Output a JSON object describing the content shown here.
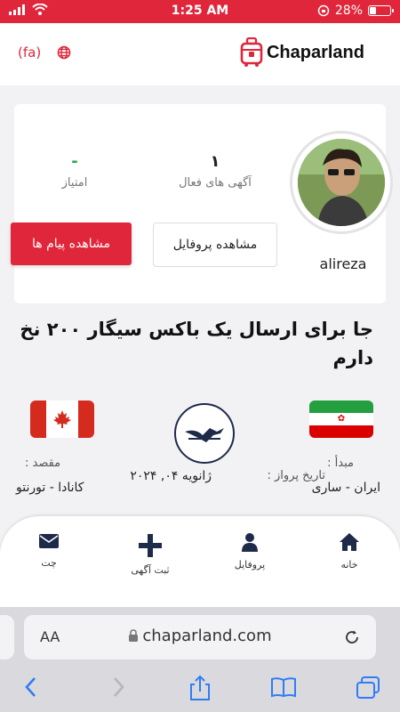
{
  "status_bar": {
    "time": "1:25 AM",
    "battery": "28%",
    "battery_level": 0.28
  },
  "header": {
    "language": "(fa)",
    "brand": "Chaparland",
    "accent_color": "#e0263b"
  },
  "profile": {
    "username": "alireza",
    "active_ads_value": "۱",
    "active_ads_label": "آگهی های فعال",
    "rating_value": "-",
    "rating_label": "امتیاز",
    "view_profile_label": "مشاهده پروفایل",
    "view_messages_label": "مشاهده پیام ها"
  },
  "listing": {
    "title": "جا برای ارسال یک باکس سیگار ۲۰۰ نخ دارم",
    "origin_label": "مبدأ :",
    "origin_value": "ایران - ساری",
    "flight_date_label": "تاریخ پرواز :",
    "flight_date_value": "ژانویه ۰۴, ۲۰۲۴",
    "destination_label": "مقصد :",
    "destination_value": "کانادا - تورنتو"
  },
  "bottom_nav": {
    "home": "خانه",
    "profile": "پروفایل",
    "post_ad": "ثبت آگهی",
    "chat": "چت"
  },
  "browser": {
    "url": "chaparland.com",
    "text_size_label": "AA"
  }
}
